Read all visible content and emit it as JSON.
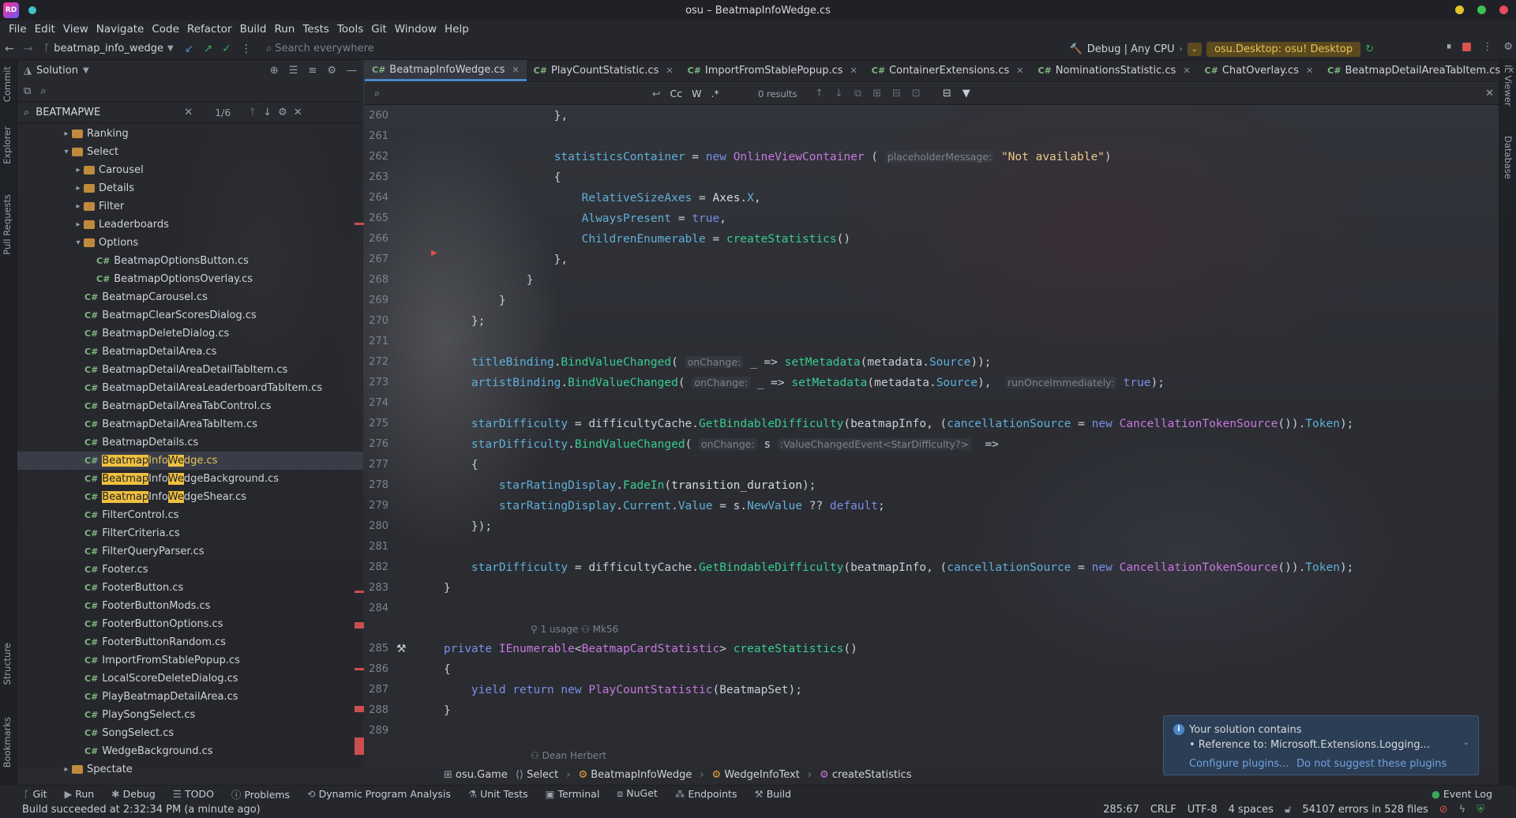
{
  "window": {
    "title": "osu – BeatmapInfoWedge.cs",
    "app_badge": "RD"
  },
  "menu": [
    "File",
    "Edit",
    "View",
    "Navigate",
    "Code",
    "Refactor",
    "Build",
    "Run",
    "Tests",
    "Tools",
    "Git",
    "Window",
    "Help"
  ],
  "toolbar": {
    "branch": "beatmap_info_wedge",
    "search_placeholder": "Search everywhere",
    "config": "Debug | Any CPU",
    "run_target": "osu.Desktop: osu! Desktop"
  },
  "left_strip": [
    "Commit",
    "Explorer",
    "Pull Requests",
    "Structure",
    "Bookmarks"
  ],
  "right_strip": [
    "IL Viewer",
    "Database"
  ],
  "project": {
    "title": "Solution",
    "search_value": "BEATMAPWE",
    "match_count": "1/6",
    "tree": [
      {
        "label": "Ranking",
        "kind": "folder",
        "indent": 3,
        "chev": "›"
      },
      {
        "label": "Select",
        "kind": "folder",
        "indent": 3,
        "chev": "⌄"
      },
      {
        "label": "Carousel",
        "kind": "folder",
        "indent": 4,
        "chev": "›"
      },
      {
        "label": "Details",
        "kind": "folder",
        "indent": 4,
        "chev": "›"
      },
      {
        "label": "Filter",
        "kind": "folder",
        "indent": 4,
        "chev": "›"
      },
      {
        "label": "Leaderboards",
        "kind": "folder",
        "indent": 4,
        "chev": "›"
      },
      {
        "label": "Options",
        "kind": "folder",
        "indent": 4,
        "chev": "⌄"
      },
      {
        "label": "BeatmapOptionsButton.cs",
        "kind": "cs",
        "indent": 6
      },
      {
        "label": "BeatmapOptionsOverlay.cs",
        "kind": "cs",
        "indent": 6
      },
      {
        "label": "BeatmapCarousel.cs",
        "kind": "cs",
        "indent": 5
      },
      {
        "label": "BeatmapClearScoresDialog.cs",
        "kind": "cs",
        "indent": 5
      },
      {
        "label": "BeatmapDeleteDialog.cs",
        "kind": "cs",
        "indent": 5
      },
      {
        "label": "BeatmapDetailArea.cs",
        "kind": "cs",
        "indent": 5
      },
      {
        "label": "BeatmapDetailAreaDetailTabItem.cs",
        "kind": "cs",
        "indent": 5
      },
      {
        "label": "BeatmapDetailAreaLeaderboardTabItem.cs",
        "kind": "cs",
        "indent": 5
      },
      {
        "label": "BeatmapDetailAreaTabControl.cs",
        "kind": "cs",
        "indent": 5
      },
      {
        "label": "BeatmapDetailAreaTabItem.cs",
        "kind": "cs",
        "indent": 5
      },
      {
        "label": "BeatmapDetails.cs",
        "kind": "cs",
        "indent": 5
      },
      {
        "label": "BeatmapInfoWedge.cs",
        "kind": "cs",
        "indent": 5,
        "selected": true,
        "parts": [
          "Beatmap",
          "Info",
          "We",
          "dge.cs"
        ]
      },
      {
        "label": "BeatmapInfoWedgeBackground.cs",
        "kind": "cs",
        "indent": 5,
        "parts": [
          "Beatmap",
          "Info",
          "We",
          "dgeBackground.cs"
        ]
      },
      {
        "label": "BeatmapInfoWedgeShear.cs",
        "kind": "cs",
        "indent": 5,
        "parts": [
          "Beatmap",
          "Info",
          "We",
          "dgeShear.cs"
        ]
      },
      {
        "label": "FilterControl.cs",
        "kind": "cs",
        "indent": 5
      },
      {
        "label": "FilterCriteria.cs",
        "kind": "cs",
        "indent": 5
      },
      {
        "label": "FilterQueryParser.cs",
        "kind": "cs",
        "indent": 5
      },
      {
        "label": "Footer.cs",
        "kind": "cs",
        "indent": 5
      },
      {
        "label": "FooterButton.cs",
        "kind": "cs",
        "indent": 5
      },
      {
        "label": "FooterButtonMods.cs",
        "kind": "cs",
        "indent": 5
      },
      {
        "label": "FooterButtonOptions.cs",
        "kind": "cs",
        "indent": 5
      },
      {
        "label": "FooterButtonRandom.cs",
        "kind": "cs",
        "indent": 5
      },
      {
        "label": "ImportFromStablePopup.cs",
        "kind": "cs",
        "indent": 5
      },
      {
        "label": "LocalScoreDeleteDialog.cs",
        "kind": "cs",
        "indent": 5
      },
      {
        "label": "PlayBeatmapDetailArea.cs",
        "kind": "cs",
        "indent": 5
      },
      {
        "label": "PlaySongSelect.cs",
        "kind": "cs",
        "indent": 5
      },
      {
        "label": "SongSelect.cs",
        "kind": "cs",
        "indent": 5
      },
      {
        "label": "WedgeBackground.cs",
        "kind": "cs",
        "indent": 5
      },
      {
        "label": "Spectate",
        "kind": "folder",
        "indent": 3,
        "chev": "›"
      }
    ]
  },
  "tabs": [
    "BeatmapInfoWedge.cs",
    "PlayCountStatistic.cs",
    "ImportFromStablePopup.cs",
    "ContainerExtensions.cs",
    "NominationsStatistic.cs",
    "ChatOverlay.cs",
    "BeatmapDetailAreaTabItem.cs"
  ],
  "find": {
    "results": "0 results",
    "opt_case": "Cc",
    "opt_word": "W",
    "opt_regex": ".*"
  },
  "editor": {
    "line_numbers": [
      "260",
      "261",
      "262",
      "263",
      "264",
      "265",
      "266",
      "267",
      "268",
      "269",
      "270",
      "271",
      "272",
      "273",
      "274",
      "275",
      "276",
      "277",
      "278",
      "279",
      "280",
      "281",
      "282",
      "283",
      "284",
      "285",
      "286",
      "287",
      "288",
      "289"
    ],
    "usage_hint": "1 usage",
    "author_hint": "Mk56",
    "author_bottom": "Dean Herbert"
  },
  "breadcrumbs": [
    "osu.Game",
    "Select",
    "BeatmapInfoWedge",
    "WedgeInfoText",
    "createStatistics"
  ],
  "notification": {
    "line1": "Your solution contains",
    "line2": "• Reference to: Microsoft.Extensions.Logging...",
    "action1": "Configure plugins...",
    "action2": "Do not suggest these plugins"
  },
  "toolwindows": [
    "Git",
    "Run",
    "Debug",
    "TODO",
    "Problems",
    "Dynamic Program Analysis",
    "Unit Tests",
    "Terminal",
    "NuGet",
    "Endpoints",
    "Build"
  ],
  "event_log": "Event Log",
  "status": {
    "message": "Build succeeded at 2:32:34 PM (a minute ago)",
    "position": "285:67",
    "line_sep": "CRLF",
    "encoding": "UTF-8",
    "indent": "4 spaces",
    "errors": "54107 errors in 528 files"
  },
  "colors": {
    "accent": "#4a88c7",
    "selection_text": "#e9c25a",
    "highlight": "#f0c040",
    "keyword": "#7a8fe8",
    "method": "#39cc8f",
    "string": "#e9c88a"
  }
}
